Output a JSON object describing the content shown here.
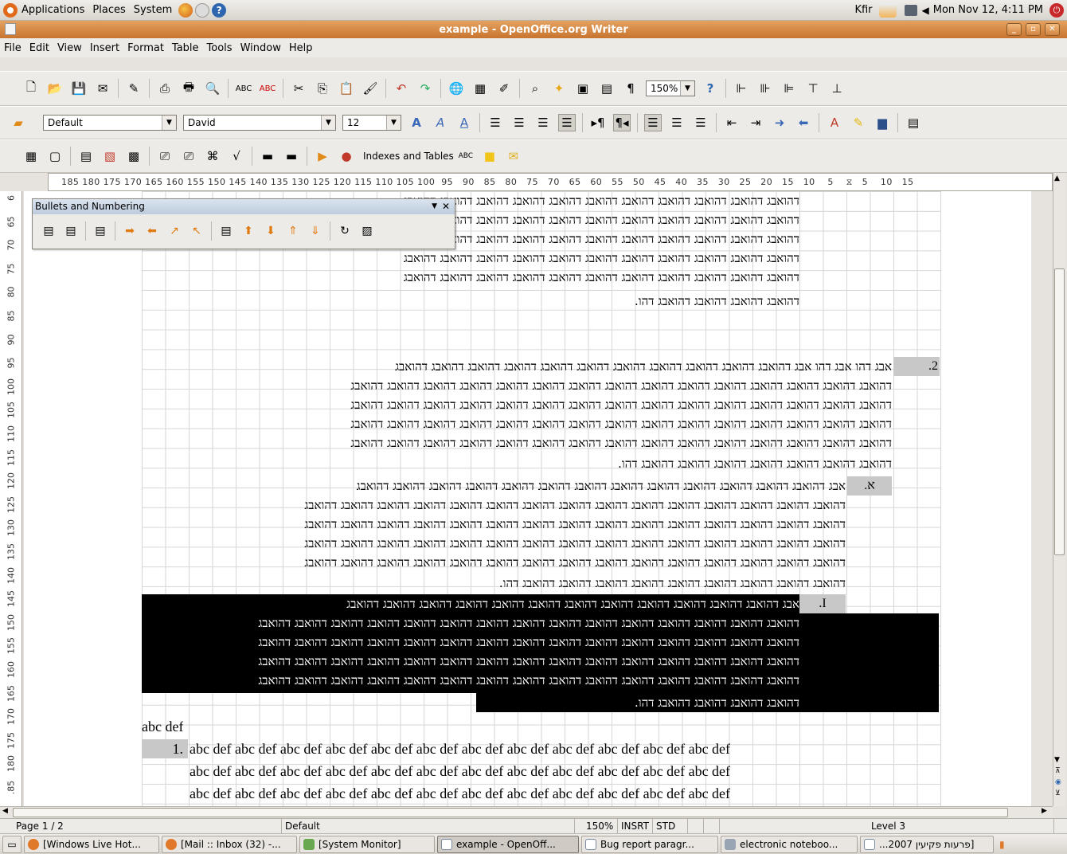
{
  "top_panel": {
    "menus": [
      "Applications",
      "Places",
      "System"
    ],
    "user": "Kfir",
    "clock": "Mon Nov 12,  4:11 PM"
  },
  "window": {
    "title": "example - OpenOffice.org Writer"
  },
  "menubar": [
    "File",
    "Edit",
    "View",
    "Insert",
    "Format",
    "Table",
    "Tools",
    "Window",
    "Help"
  ],
  "toolbar": {
    "zoom": "150%",
    "paragraph_style": "Default",
    "font_name": "David",
    "font_size": "12",
    "indexes_label": "Indexes and Tables"
  },
  "ruler_text": "185 180 175 170 165 160 155 150 145 140 135 130 125 120 115 110 105 100  95   90   85   80   75   70   65   60   55   50   45   40   35   30   25   20   15   10    5    ⧖   5    10   15",
  "vruler": [
    "6",
    "65",
    "70",
    "75",
    "80",
    "85",
    "90",
    "95",
    "100",
    "105",
    "110",
    "115",
    "120",
    "125",
    "130",
    "135",
    "140",
    "145",
    "150",
    "155",
    "160",
    "165",
    "170",
    "175",
    "180",
    ".85"
  ],
  "bullets_toolbar": {
    "title": "Bullets and Numbering"
  },
  "document": {
    "hebrew_full": "דהואבג דהואבג דהואבג דהואבג דהואבג דהואבג דהואבג דהואבג דהואבג דהואבג דהואבג דהואבג דהואבג דהואבג דהואבג",
    "hebrew_top": "דהואבג דהואבג דהואבג דהואבג דהואבג דהואבג דהואבג דהואבג דהואבג דהואבג דהואבג",
    "hebrew_top_end": "דהואבג דהואבג דהואבג דהואבג דהו.",
    "item2_first": "אבג דהו אבג דהו אבג דהואבג דהואבג דהואבג דהואבג דהואבג דהואבג דהואבג דהואבג דהואבג דהואבג דהואבג",
    "item2_end": "דהואבג דהואבג דהואבג דהואבג דהואבג דהואבג דהואבג דהו.",
    "itemA_first": "אבג דהואבג דהואבג דהואבג דהואבג דהואבג דהואבג דהואבג דהואבג דהואבג דהואבג דהואבג דהואבג דהואבג",
    "itemA_end": "דהואבג דהואבג דהואבג דהואבג דהואבג דהואבג דהואבג דהואבג דהואבג דהו.",
    "itemI_first": "אבג דהואבג דהואבג דהואבג דהואבג דהואבג דהואבג דהואבג דהואבג דהואבג דהואבג דהואבג דהואבג",
    "itemI_end": "דהואבג דהואבג דהואבג דהואבג דהו.",
    "num_2": ".2",
    "num_A": ".א",
    "num_I": ".I",
    "num_1": "1.",
    "abc_heading": "abc def",
    "abc_line": "abc def abc def abc def abc def abc def abc def abc def abc def abc def abc def abc def abc def"
  },
  "statusbar": {
    "page": "Page 1 / 2",
    "style": "Default",
    "zoom": "150%",
    "insert_mode": "INSRT",
    "selection_mode": "STD",
    "level": "Level 3"
  },
  "taskbar": [
    "[Windows Live Hot...",
    "[Mail :: Inbox (32) -...",
    "[System Monitor]",
    "example - OpenOff...",
    "Bug report paragr...",
    "electronic noteboo...",
    "[פרעות פקיעין 2007..."
  ]
}
